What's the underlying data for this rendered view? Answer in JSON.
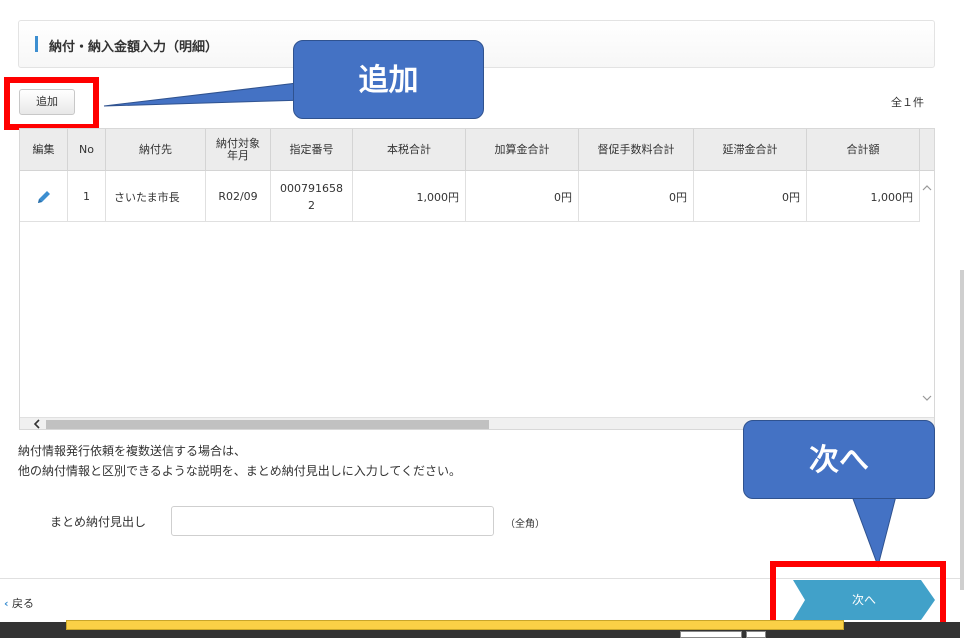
{
  "section": {
    "title": "納付・納入金額入力（明細）"
  },
  "toolbar": {
    "add_label": "追加",
    "count_label": "全１件"
  },
  "annotations": {
    "add_callout": "追加",
    "next_callout": "次へ",
    "callout_color": "#4472c4",
    "highlight_color": "#ff0000"
  },
  "table": {
    "columns": [
      "編集",
      "No",
      "納付先",
      "納付対象年月",
      "指定番号",
      "本税合計",
      "加算金合計",
      "督促手数料合計",
      "延滞金合計",
      "合計額"
    ],
    "rows": [
      {
        "edit_icon": "pencil-icon",
        "no": "1",
        "payee": "さいたま市長",
        "period": "R02/09",
        "number": "0007916582",
        "principal": "1,000円",
        "additional": "0円",
        "fee": "0円",
        "delay": "0円",
        "total": "1,000円"
      }
    ]
  },
  "info": {
    "line1": "納付情報発行依頼を複数送信する場合は、",
    "line2": "他の納付情報と区別できるような説明を、まとめ納付見出しに入力してください。"
  },
  "form": {
    "heading_label": "まとめ納付見出し",
    "heading_value": "",
    "heading_note": "（全角）"
  },
  "footer": {
    "back_label": "戻る",
    "next_label": "次へ",
    "next_color": "#41a1c9",
    "progress_color": "#fbd046"
  }
}
